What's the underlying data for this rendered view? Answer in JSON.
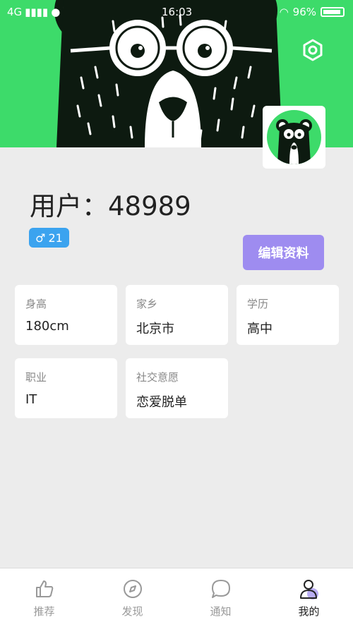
{
  "status_bar": {
    "network": "4G",
    "time": "16:03",
    "battery": "96%"
  },
  "profile": {
    "username": "用户：48989",
    "gender_symbol": "♂",
    "age": "21",
    "edit_label": "编辑资料"
  },
  "info_cards": [
    {
      "label": "身高",
      "value": "180cm"
    },
    {
      "label": "家乡",
      "value": "北京市"
    },
    {
      "label": "学历",
      "value": "高中"
    },
    {
      "label": "职业",
      "value": "IT"
    },
    {
      "label": "社交意愿",
      "value": "恋爱脱单"
    }
  ],
  "tabs": [
    {
      "label": "推荐",
      "icon": "thumbs-up-icon"
    },
    {
      "label": "发现",
      "icon": "compass-icon"
    },
    {
      "label": "通知",
      "icon": "chat-bubble-icon"
    },
    {
      "label": "我的",
      "icon": "user-icon"
    }
  ],
  "colors": {
    "banner": "#3ddb6a",
    "edit_button": "#9e8cf0",
    "gender_badge": "#3ba3ef",
    "active_tab": "#222222"
  }
}
